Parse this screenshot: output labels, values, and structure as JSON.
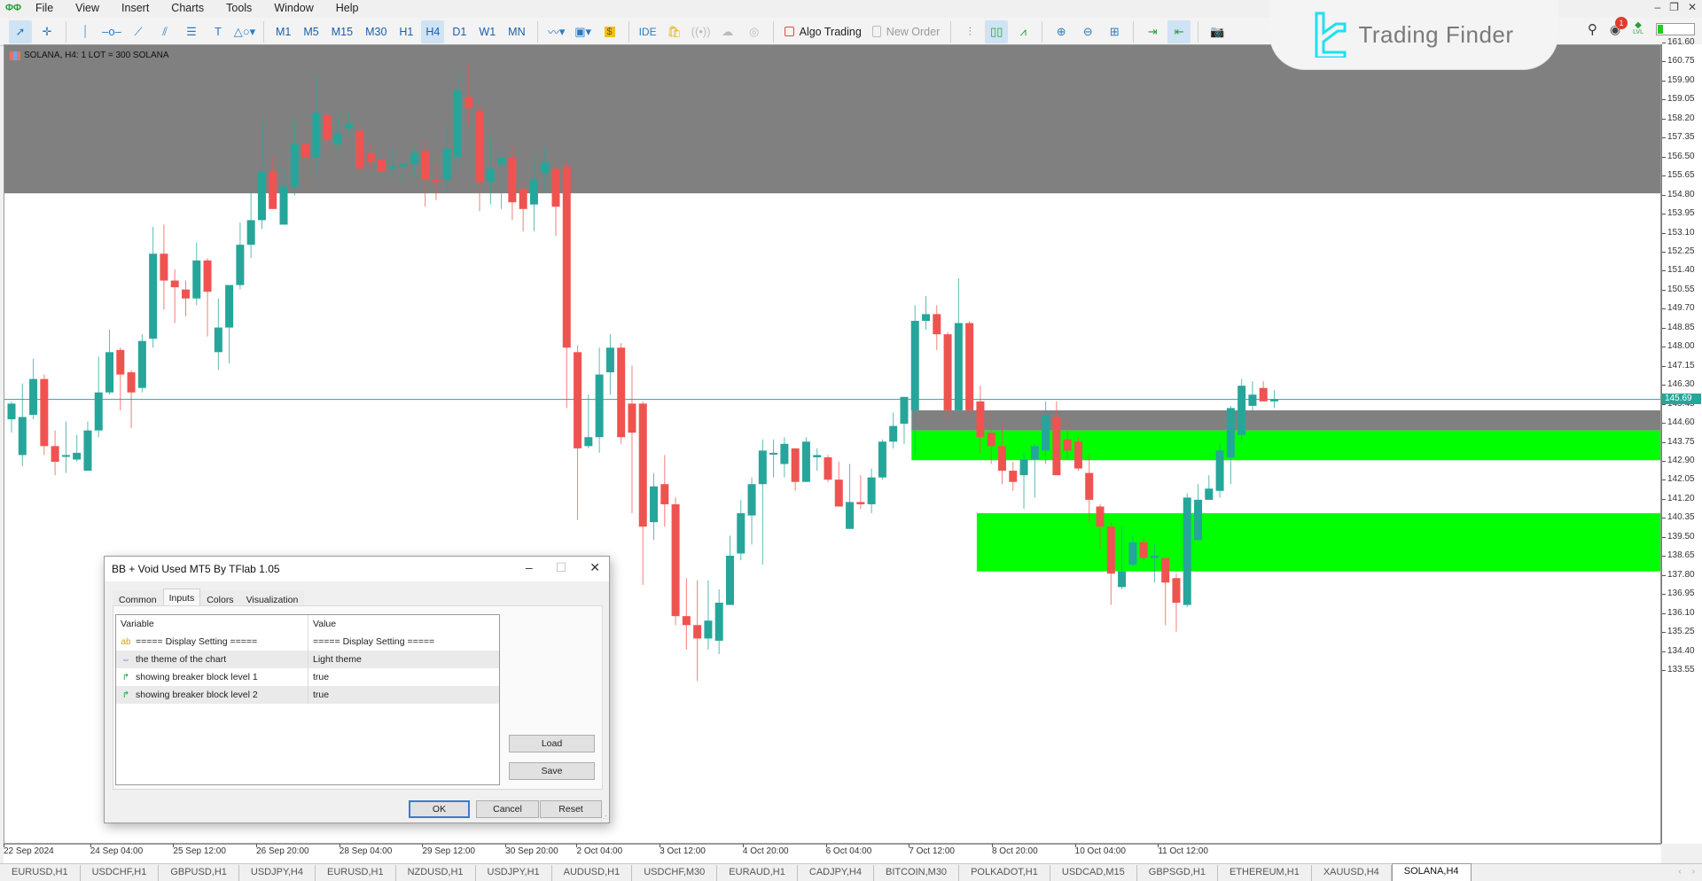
{
  "menu": {
    "items": [
      "File",
      "View",
      "Insert",
      "Charts",
      "Tools",
      "Window",
      "Help"
    ]
  },
  "toolbar": {
    "timeframes": [
      "M1",
      "M5",
      "M15",
      "M30",
      "H1",
      "H4",
      "D1",
      "W1",
      "MN"
    ],
    "active_timeframe": "H4",
    "ide_label": "IDE",
    "algo_trading_label": "Algo Trading",
    "new_order_label": "New Order"
  },
  "branding": {
    "logo_text": "Trading Finder",
    "notification_count": "1",
    "level_label": "LVL"
  },
  "chart": {
    "header_label": "SOLANA, H4:  1 LOT = 300 SOLANA",
    "current_price": "145.69",
    "colors": {
      "bull": "#26a69a",
      "bear": "#ef5350",
      "gray_zone": "#808080",
      "green_zone": "#00ff00",
      "price_line": "#26a69a"
    }
  },
  "chart_data": {
    "type": "candlestick",
    "symbol": "SOLANA",
    "timeframe": "H4",
    "ylim": [
      133.0,
      161.8
    ],
    "y_ticks": [
      "161.60",
      "160.75",
      "159.90",
      "159.05",
      "158.20",
      "157.35",
      "156.50",
      "155.65",
      "154.80",
      "153.95",
      "153.10",
      "152.25",
      "151.40",
      "150.55",
      "149.70",
      "148.85",
      "148.00",
      "147.15",
      "146.30",
      "145.45",
      "144.60",
      "143.75",
      "142.90",
      "142.05",
      "141.20",
      "140.35",
      "139.50",
      "138.65",
      "137.80",
      "136.95",
      "136.10",
      "135.25",
      "134.40",
      "133.55"
    ],
    "x_ticks": [
      "22 Sep 2024",
      "24 Sep 04:00",
      "25 Sep 12:00",
      "26 Sep 20:00",
      "28 Sep 04:00",
      "29 Sep 12:00",
      "30 Sep 20:00",
      "2 Oct 04:00",
      "3 Oct 12:00",
      "4 Oct 20:00",
      "6 Oct 04:00",
      "7 Oct 12:00",
      "8 Oct 20:00",
      "10 Oct 04:00",
      "11 Oct 12:00"
    ],
    "zones": [
      {
        "name": "top-gray-zone",
        "color": "gray",
        "from_bar": 0,
        "low": 154.9,
        "high": 161.8
      },
      {
        "name": "breaker-gray-zone",
        "color": "gray",
        "from_bar": 83,
        "low": 144.3,
        "high": 145.2
      },
      {
        "name": "breaker-green-zone-1",
        "color": "green",
        "from_bar": 83,
        "low": 142.97,
        "high": 144.3
      },
      {
        "name": "breaker-green-zone-2",
        "color": "green",
        "from_bar": 89,
        "low": 138.0,
        "high": 140.6
      }
    ],
    "ohlc": [
      [
        144.8,
        145.5,
        144.2,
        145.6
      ],
      [
        143.2,
        144.9,
        142.7,
        146.4
      ],
      [
        145.0,
        146.6,
        144.8,
        147.5
      ],
      [
        146.6,
        143.6,
        143.2,
        146.8
      ],
      [
        143.6,
        142.9,
        142.3,
        144.3
      ],
      [
        143.2,
        143.2,
        142.4,
        144.7
      ],
      [
        143.0,
        143.3,
        142.9,
        144.1
      ],
      [
        142.5,
        144.3,
        142.5,
        144.7
      ],
      [
        144.3,
        146.0,
        144.0,
        147.6
      ],
      [
        146.0,
        147.8,
        145.9,
        148.8
      ],
      [
        147.9,
        146.8,
        145.2,
        148.0
      ],
      [
        146.9,
        146.0,
        144.4,
        147.0
      ],
      [
        146.2,
        148.3,
        146.0,
        148.6
      ],
      [
        148.4,
        152.2,
        148.0,
        153.4
      ],
      [
        152.2,
        151.0,
        149.7,
        153.5
      ],
      [
        151.0,
        150.7,
        149.1,
        151.5
      ],
      [
        150.6,
        150.2,
        149.4,
        151.0
      ],
      [
        150.2,
        151.9,
        149.9,
        152.7
      ],
      [
        151.9,
        150.5,
        148.5,
        152.0
      ],
      [
        147.8,
        148.9,
        147.0,
        150.2
      ],
      [
        148.9,
        150.8,
        147.3,
        150.7
      ],
      [
        150.8,
        152.6,
        150.6,
        153.6
      ],
      [
        152.6,
        153.7,
        152.0,
        155.1
      ],
      [
        153.7,
        155.9,
        153.3,
        158.3
      ],
      [
        155.9,
        154.2,
        154.8,
        156.6
      ],
      [
        153.5,
        155.2,
        153.5,
        156.0
      ],
      [
        155.2,
        157.1,
        154.8,
        158.2
      ],
      [
        157.1,
        156.5,
        155.2,
        157.9
      ],
      [
        156.5,
        158.5,
        155.8,
        160.2
      ],
      [
        158.4,
        157.3,
        156.8,
        158.5
      ],
      [
        157.1,
        157.6,
        156.8,
        158.4
      ],
      [
        157.8,
        158.0,
        157.5,
        158.5
      ],
      [
        157.7,
        156.0,
        155.8,
        158.0
      ],
      [
        156.7,
        156.3,
        155.9,
        157.2
      ],
      [
        156.4,
        155.9,
        155.5,
        156.8
      ],
      [
        156.0,
        156.1,
        155.6,
        156.9
      ],
      [
        156.1,
        156.2,
        155.4,
        156.3
      ],
      [
        156.2,
        156.7,
        155.6,
        157.0
      ],
      [
        156.8,
        155.5,
        154.3,
        157.3
      ],
      [
        155.5,
        155.4,
        154.6,
        156.2
      ],
      [
        155.5,
        156.9,
        155.0,
        158.0
      ],
      [
        156.5,
        159.5,
        156.0,
        160.4
      ],
      [
        159.2,
        158.7,
        158.0,
        160.8
      ],
      [
        158.6,
        155.4,
        154.1,
        159.0
      ],
      [
        155.4,
        156.0,
        154.4,
        157.4
      ],
      [
        156.2,
        156.5,
        154.2,
        157.0
      ],
      [
        156.5,
        154.5,
        153.7,
        157.0
      ],
      [
        155.1,
        154.2,
        153.2,
        155.4
      ],
      [
        154.4,
        155.5,
        153.2,
        156.7
      ],
      [
        155.8,
        156.3,
        155.0,
        157.0
      ],
      [
        156.0,
        154.3,
        153.0,
        156.1
      ],
      [
        156.1,
        148.0,
        145.3,
        156.5
      ],
      [
        147.8,
        143.5,
        140.3,
        148.1
      ],
      [
        143.6,
        144.0,
        143.5,
        145.9
      ],
      [
        144.0,
        146.8,
        143.3,
        148.0
      ],
      [
        146.9,
        148.0,
        145.9,
        148.6
      ],
      [
        148.0,
        144.0,
        143.7,
        148.2
      ],
      [
        145.5,
        144.2,
        140.6,
        147.2
      ],
      [
        145.5,
        140.0,
        137.4,
        145.6
      ],
      [
        140.2,
        141.8,
        139.4,
        142.4
      ],
      [
        141.9,
        141.0,
        140.0,
        143.2
      ],
      [
        141.0,
        136.0,
        135.6,
        141.3
      ],
      [
        136.0,
        135.6,
        134.5,
        137.7
      ],
      [
        135.6,
        135.0,
        133.1,
        137.6
      ],
      [
        135.0,
        135.8,
        134.5,
        137.6
      ],
      [
        134.9,
        136.6,
        134.3,
        137.2
      ],
      [
        136.5,
        138.7,
        136.5,
        139.6
      ],
      [
        138.8,
        140.6,
        138.5,
        141.2
      ],
      [
        140.5,
        141.9,
        139.2,
        142.2
      ],
      [
        141.9,
        143.4,
        138.3,
        143.9
      ],
      [
        143.3,
        143.3,
        142.2,
        143.9
      ],
      [
        142.8,
        143.7,
        142.2,
        144.0
      ],
      [
        143.5,
        142.0,
        141.6,
        143.5
      ],
      [
        142.0,
        143.8,
        142.1,
        144.0
      ],
      [
        143.1,
        143.2,
        142.5,
        143.5
      ],
      [
        143.1,
        142.1,
        142.0,
        143.2
      ],
      [
        142.1,
        140.9,
        140.9,
        142.9
      ],
      [
        139.9,
        141.1,
        139.9,
        142.8
      ],
      [
        141.1,
        141.0,
        140.8,
        142.3
      ],
      [
        141.0,
        142.2,
        140.6,
        142.6
      ],
      [
        142.2,
        143.8,
        142.1,
        143.9
      ],
      [
        143.8,
        144.5,
        143.5,
        145.1
      ],
      [
        144.6,
        145.8,
        143.7,
        145.2
      ],
      [
        145.2,
        149.2,
        143.2,
        149.9
      ],
      [
        149.2,
        149.5,
        148.8,
        150.3
      ],
      [
        149.5,
        148.6,
        147.9,
        149.9
      ],
      [
        148.6,
        145.2,
        144.7,
        148.7
      ],
      [
        145.2,
        149.1,
        145.3,
        151.1
      ],
      [
        149.1,
        145.2,
        144.9,
        149.2
      ],
      [
        145.6,
        144.0,
        143.3,
        146.3
      ],
      [
        144.2,
        143.6,
        142.8,
        145.2
      ],
      [
        143.6,
        142.5,
        141.9,
        144.6
      ],
      [
        142.5,
        142.0,
        141.6,
        142.9
      ],
      [
        142.3,
        143.0,
        140.8,
        143.3
      ],
      [
        143.0,
        143.6,
        141.3,
        143.7
      ],
      [
        143.4,
        145.0,
        142.8,
        145.6
      ],
      [
        144.9,
        142.3,
        142.8,
        145.6
      ],
      [
        143.9,
        143.4,
        143.0,
        144.8
      ],
      [
        143.8,
        142.6,
        142.5,
        144.0
      ],
      [
        142.4,
        141.2,
        140.2,
        143.2
      ],
      [
        140.9,
        140.0,
        139.0,
        141.0
      ],
      [
        140.0,
        137.9,
        136.5,
        140.2
      ],
      [
        137.3,
        138.0,
        137.2,
        140.0
      ],
      [
        138.3,
        139.3,
        138.2,
        139.6
      ],
      [
        139.3,
        138.6,
        138.5,
        139.5
      ],
      [
        138.6,
        138.7,
        137.5,
        139.2
      ],
      [
        138.6,
        137.5,
        135.6,
        138.4
      ],
      [
        137.7,
        136.6,
        135.3,
        137.9
      ],
      [
        136.5,
        141.3,
        136.4,
        141.5
      ],
      [
        139.4,
        141.2,
        140.0,
        141.9
      ],
      [
        141.2,
        141.7,
        141.2,
        142.3
      ],
      [
        141.6,
        143.4,
        141.3,
        143.7
      ],
      [
        143.1,
        145.3,
        141.9,
        145.4
      ],
      [
        144.1,
        146.3,
        143.8,
        146.6
      ],
      [
        145.4,
        145.9,
        145.2,
        146.5
      ],
      [
        146.2,
        145.6,
        145.7,
        146.5
      ],
      [
        145.6,
        145.7,
        145.3,
        146.1
      ]
    ]
  },
  "dialog": {
    "title": "BB + Void Used MT5 By TFlab 1.05",
    "tabs": [
      "Common",
      "Inputs",
      "Colors",
      "Visualization"
    ],
    "active_tab": "Inputs",
    "columns": [
      "Variable",
      "Value"
    ],
    "rows": [
      {
        "icon": "text-param-icon",
        "variable": "===== Display Setting =====",
        "value": "===== Display Setting ====="
      },
      {
        "icon": "enum-param-icon",
        "variable": "the theme of the chart",
        "value": "Light theme"
      },
      {
        "icon": "bool-param-icon",
        "variable": "showing breaker block level 1",
        "value": "true"
      },
      {
        "icon": "bool-param-icon",
        "variable": "showing breaker block level 2",
        "value": "true"
      }
    ],
    "buttons": {
      "load": "Load",
      "save": "Save",
      "ok": "OK",
      "cancel": "Cancel",
      "reset": "Reset"
    }
  },
  "chart_tabs": [
    "EURUSD,H1",
    "USDCHF,H1",
    "GBPUSD,H1",
    "USDJPY,H4",
    "EURUSD,H1",
    "NZDUSD,H1",
    "USDJPY,H1",
    "AUDUSD,H1",
    "USDCHF,M30",
    "EURAUD,H1",
    "CADJPY,H4",
    "BITCOIN,M30",
    "POLKADOT,H1",
    "USDCAD,M15",
    "GBPSGD,H1",
    "ETHEREUM,H1",
    "XAUUSD,H4",
    "SOLANA,H4"
  ],
  "active_chart_tab": "SOLANA,H4"
}
